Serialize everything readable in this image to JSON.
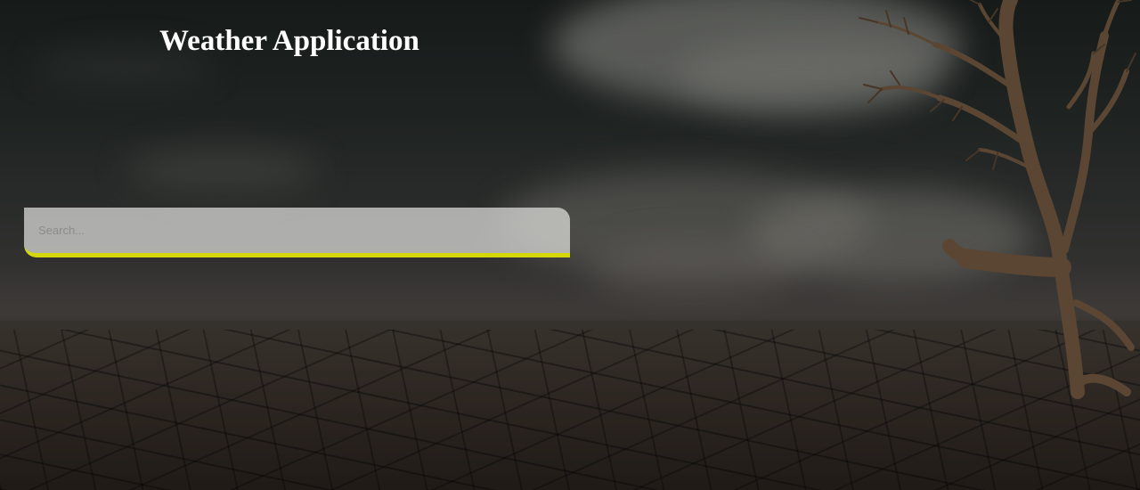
{
  "app": {
    "title": "Weather Application"
  },
  "search": {
    "placeholder": "Search...",
    "value": "",
    "accent_color": "#d4d80a"
  }
}
